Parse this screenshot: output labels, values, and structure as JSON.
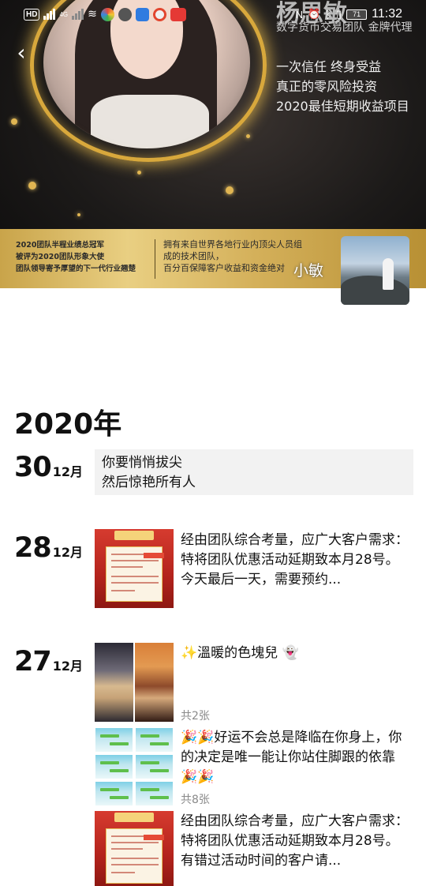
{
  "status_bar": {
    "left_chips": [
      "HD",
      "4G"
    ],
    "battery": "71",
    "time": "11:32"
  },
  "cover": {
    "name": "杨思敏",
    "agent_line": "数字货币交易团队 金牌代理",
    "slogans": [
      "一次信任 终身受益",
      "真正的零风险投资",
      "2020最佳短期收益项目"
    ],
    "banner_left": [
      "2020团队半程业绩总冠军",
      "被评为2020团队形象大使",
      "团队领导寄予厚望的下一代行业翘楚"
    ],
    "banner_right": [
      "拥有来自世界各地行业内顶尖人员组",
      "成的技术团队，",
      "百分百保障客户收益和资金绝对"
    ],
    "nickname": "小敏"
  },
  "timeline": {
    "year": "2020年",
    "entries": [
      {
        "day": "30",
        "month": "12月",
        "text_lines": [
          "你要悄悄拔尖",
          "然后惊艳所有人"
        ]
      },
      {
        "day": "28",
        "month": "12月",
        "text": "经由团队综合考量，应广大客户需求：特将团队优惠活动延期致本月28号。今天最后一天，需要预约..."
      },
      {
        "day": "27",
        "month": "12月",
        "posts": [
          {
            "text": "✨溫暖的色塊兒 👻",
            "count": "共2张"
          },
          {
            "text": "🎉🎉好运不会总是降临在你身上，你的决定是唯一能让你站住脚跟的依靠🎉🎉",
            "count": "共8张"
          },
          {
            "text": "经由团队综合考量，应广大客户需求：特将团队优惠活动延期致本月28号。有错过活动时间的客户请..."
          }
        ]
      }
    ]
  }
}
